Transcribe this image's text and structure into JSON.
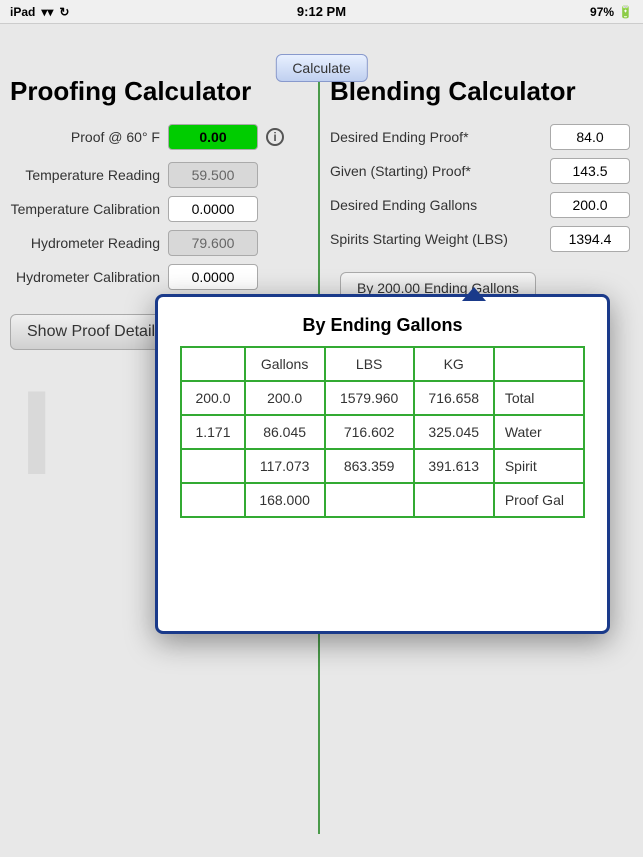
{
  "status": {
    "device": "iPad",
    "wifi": "wifi",
    "time": "9:12 PM",
    "battery": "97%"
  },
  "calculate_button": "Calculate",
  "proofing": {
    "header": "Proofing Calculator",
    "proof_label": "Proof @ 60° F",
    "proof_value": "0.00",
    "temp_reading_label": "Temperature Reading",
    "temp_reading_value": "59.500",
    "temp_calibration_label": "Temperature Calibration",
    "temp_calibration_value": "0.0000",
    "hydro_reading_label": "Hydrometer Reading",
    "hydro_reading_value": "79.600",
    "hydro_calibration_label": "Hydrometer Calibration",
    "hydro_calibration_value": "0.0000",
    "show_proof_details": "Show Proof Details"
  },
  "blending": {
    "header": "Blending Calculator",
    "desired_ending_proof_label": "Desired Ending Proof*",
    "desired_ending_proof_value": "84.0",
    "given_starting_proof_label": "Given (Starting) Proof*",
    "given_starting_proof_value": "143.5",
    "desired_ending_gallons_label": "Desired Ending Gallons",
    "desired_ending_gallons_value": "200.0",
    "spirits_starting_weight_label": "Spirits Starting Weight (LBS)",
    "spirits_starting_weight_value": "1394.4",
    "by_ending_gallons_button": "By 200.00 Ending Gallons"
  },
  "modal": {
    "title": "By Ending Gallons",
    "columns": [
      "",
      "Gallons",
      "LBS",
      "KG",
      ""
    ],
    "rows": [
      {
        "col0": "200.0",
        "col1": "200.0",
        "col2": "1579.960",
        "col3": "716.658",
        "label": "Total"
      },
      {
        "col0": "1.171",
        "col1": "86.045",
        "col2": "716.602",
        "col3": "325.045",
        "label": "Water"
      },
      {
        "col0": "",
        "col1": "117.073",
        "col2": "863.359",
        "col3": "391.613",
        "label": "Spirit"
      },
      {
        "col0": "",
        "col1": "168.000",
        "col2": "",
        "col3": "",
        "label": "Proof Gal"
      }
    ]
  }
}
